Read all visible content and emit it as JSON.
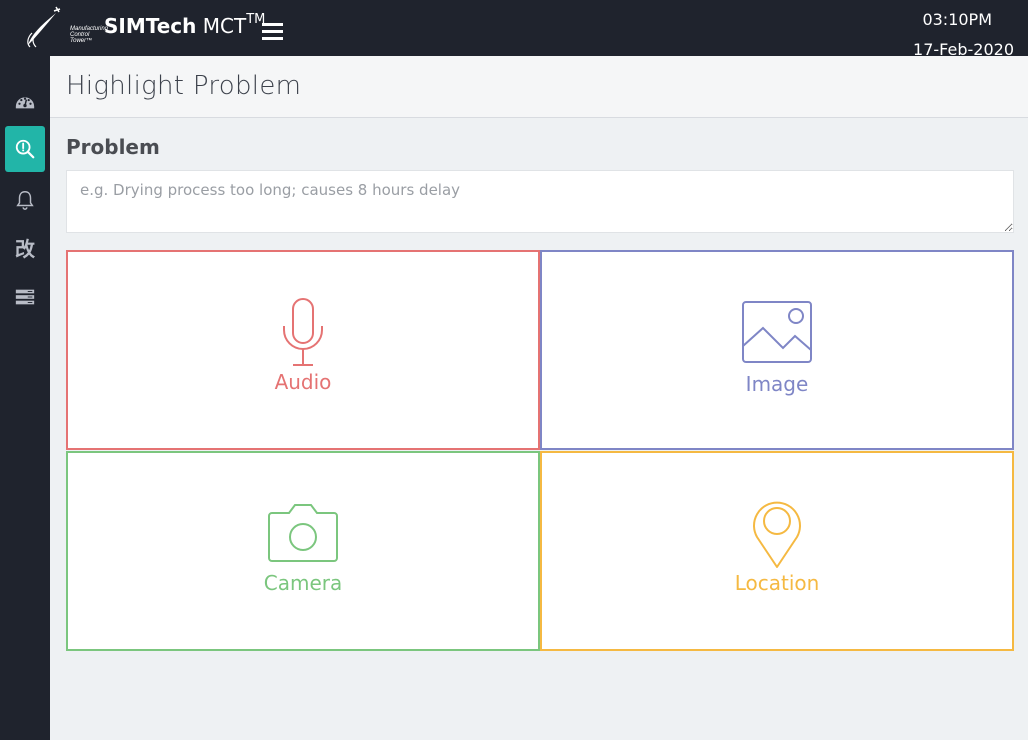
{
  "header": {
    "logo_text": [
      "Manufacturing",
      "Control",
      "Tower™"
    ],
    "brand_bold": "SIMTech",
    "brand_light": "MCT",
    "brand_sup": "TM",
    "time": "03:10PM",
    "date": "17-Feb-2020"
  },
  "sidebar": {
    "items": [
      {
        "icon": "dashboard-gauge-icon",
        "active": false
      },
      {
        "icon": "search-alert-icon",
        "active": true
      },
      {
        "icon": "bell-icon",
        "active": false
      },
      {
        "icon": "kaizen-icon",
        "glyph": "改",
        "active": false
      },
      {
        "icon": "server-list-icon",
        "active": false
      }
    ]
  },
  "page": {
    "title": "Highlight Problem",
    "problem_label": "Problem",
    "problem_placeholder": "e.g. Drying process too long; causes 8 hours delay",
    "problem_value": ""
  },
  "tiles": [
    {
      "id": "audio",
      "label": "Audio",
      "icon": "microphone-icon",
      "color": "#e57373"
    },
    {
      "id": "image",
      "label": "Image",
      "icon": "image-icon",
      "color": "#7f86c6"
    },
    {
      "id": "camera",
      "label": "Camera",
      "icon": "camera-icon",
      "color": "#7bc67e"
    },
    {
      "id": "location",
      "label": "Location",
      "icon": "map-pin-icon",
      "color": "#f5b942"
    }
  ]
}
